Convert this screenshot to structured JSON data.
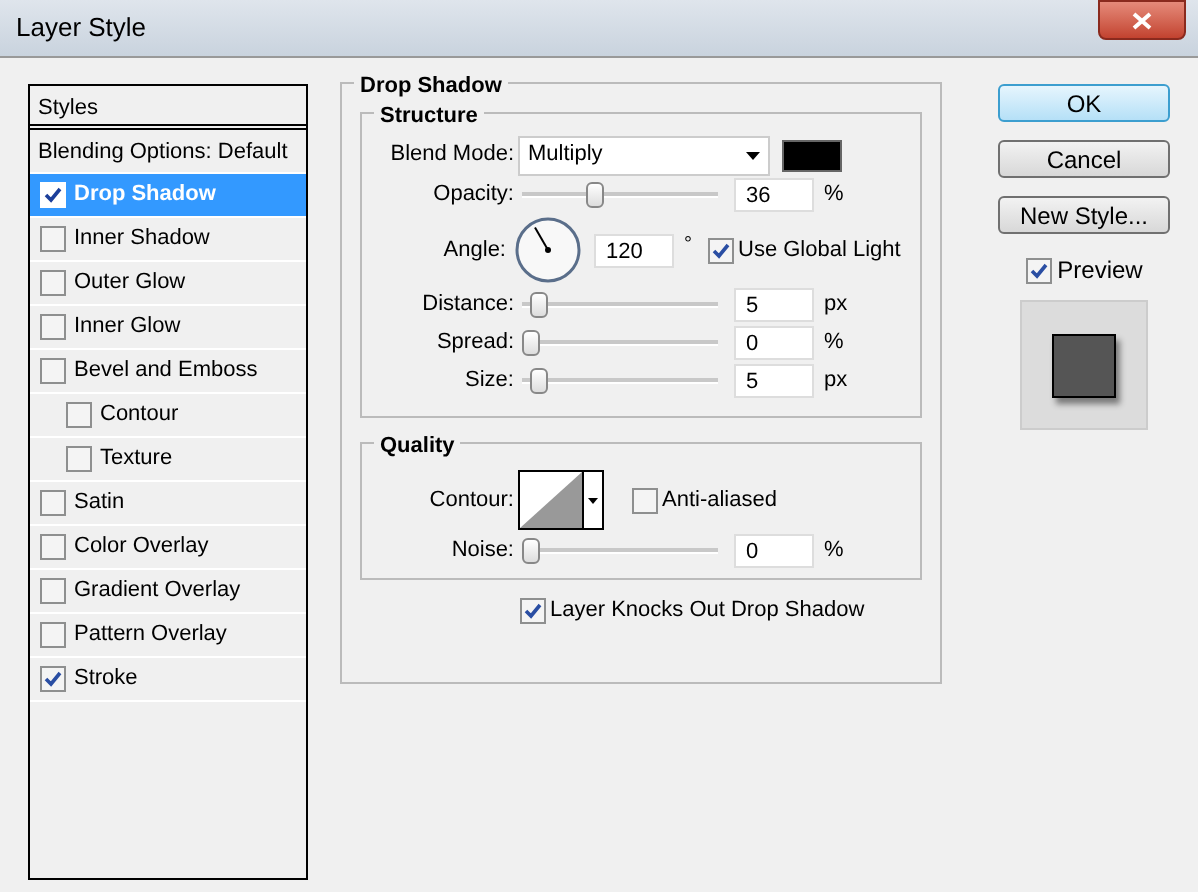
{
  "window": {
    "title": "Layer Style"
  },
  "styles_panel": {
    "header": "Styles",
    "blending_options": "Blending Options: Default",
    "items": [
      {
        "label": "Drop Shadow",
        "checked": true,
        "selected": true
      },
      {
        "label": "Inner Shadow",
        "checked": false,
        "selected": false
      },
      {
        "label": "Outer Glow",
        "checked": false,
        "selected": false
      },
      {
        "label": "Inner Glow",
        "checked": false,
        "selected": false
      },
      {
        "label": "Bevel and Emboss",
        "checked": false,
        "selected": false,
        "children": [
          {
            "label": "Contour",
            "checked": false,
            "selected": false
          },
          {
            "label": "Texture",
            "checked": false,
            "selected": false
          }
        ]
      },
      {
        "label": "Satin",
        "checked": false,
        "selected": false
      },
      {
        "label": "Color Overlay",
        "checked": false,
        "selected": false
      },
      {
        "label": "Gradient Overlay",
        "checked": false,
        "selected": false
      },
      {
        "label": "Pattern Overlay",
        "checked": false,
        "selected": false
      },
      {
        "label": "Stroke",
        "checked": true,
        "selected": false
      }
    ]
  },
  "drop_shadow": {
    "title": "Drop Shadow",
    "structure": {
      "title": "Structure",
      "blend_mode": {
        "label": "Blend Mode:",
        "value": "Multiply"
      },
      "opacity": {
        "label": "Opacity:",
        "level": 0.36,
        "value": "36",
        "unit": "%"
      },
      "angle": {
        "label": "Angle:",
        "value": "120",
        "unit": "°",
        "use_global_light": {
          "label": "Use Global Light",
          "checked": true
        }
      },
      "sliders": [
        {
          "label": "Distance:",
          "level": 0.05,
          "value": "5",
          "unit": "px"
        },
        {
          "label": "Spread:",
          "level": 0,
          "value": "0",
          "unit": "%"
        },
        {
          "label": "Size:",
          "level": 0.05,
          "value": "5",
          "unit": "px"
        }
      ]
    },
    "quality": {
      "title": "Quality",
      "contour": {
        "label": "Contour:"
      },
      "anti_aliased": {
        "label": "Anti-aliased",
        "checked": false
      },
      "noise": {
        "label": "Noise:",
        "level": 0,
        "value": "0",
        "unit": "%"
      }
    },
    "knocks_out": {
      "label": "Layer Knocks Out Drop Shadow",
      "checked": true
    }
  },
  "buttons": [
    {
      "label": "OK",
      "default": true
    },
    {
      "label": "Cancel",
      "default": false
    },
    {
      "label": "New Style...",
      "default": false
    }
  ],
  "preview": {
    "label": "Preview",
    "checked": true
  }
}
